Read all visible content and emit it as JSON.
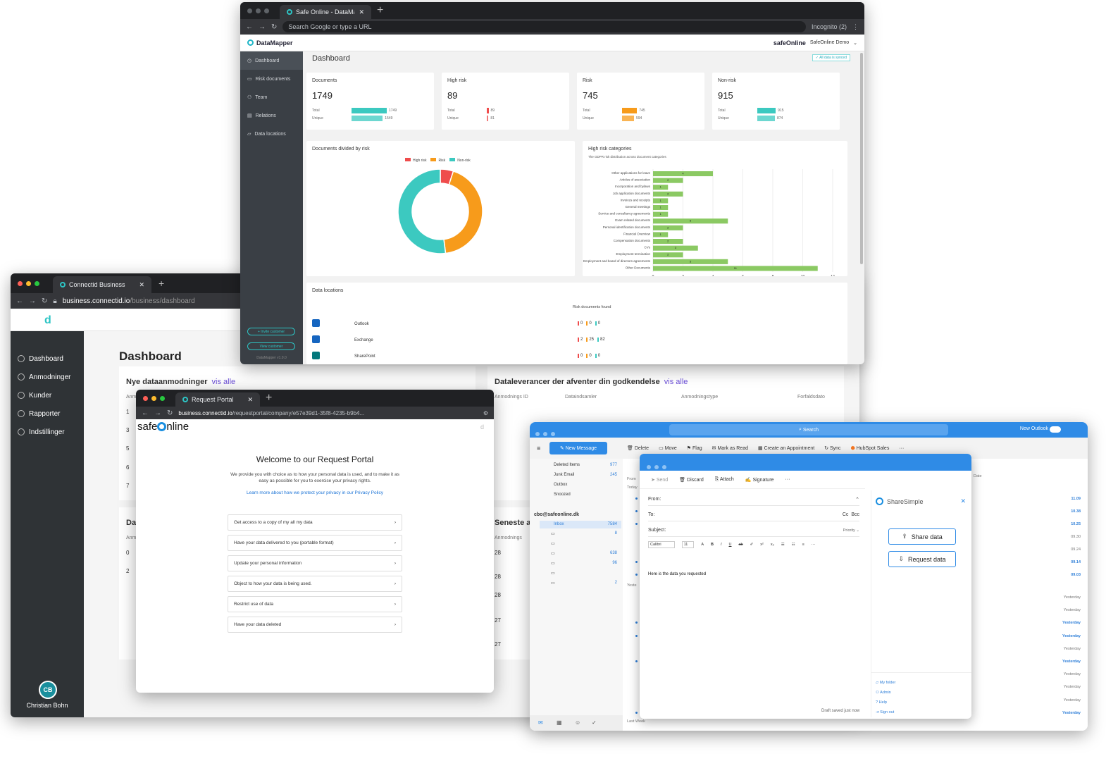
{
  "datamapper": {
    "tab_title": "Safe Online - DataMapper",
    "address_placeholder": "Search Google or type a URL",
    "incognito": "Incognito (2)",
    "app_name": "DataMapper",
    "brand": "safeOnline",
    "account": "SafeOnline Demo",
    "page_title": "Dashboard",
    "synced": "✓ All data is synced",
    "nav": [
      "Dashboard",
      "Risk documents",
      "Team",
      "Relations",
      "Data locations"
    ],
    "invite_btn": "+ Invite customer",
    "view_btn": "View customer",
    "version": "DataMapper v1.0.0",
    "stats": [
      {
        "label": "Documents",
        "value": "1749",
        "total": "1749",
        "unique": "1549",
        "color": "#3cc9c0"
      },
      {
        "label": "High risk",
        "value": "89",
        "total": "89",
        "unique": "81",
        "color": "#ef4c4c"
      },
      {
        "label": "Risk",
        "value": "745",
        "total": "745",
        "unique": "594",
        "color": "#f79b1b"
      },
      {
        "label": "Non-risk",
        "value": "915",
        "total": "915",
        "unique": "874",
        "color": "#3cc9c0"
      }
    ],
    "total_label": "Total",
    "unique_label": "Unique",
    "donut_title": "Documents divided by risk",
    "legend": [
      "High risk",
      "Risk",
      "Non-risk"
    ],
    "donut_fractions": [
      0.05,
      0.43,
      0.52
    ],
    "hbar_title": "High risk categories",
    "hbar_subtitle": "The GDPR risk distribution across document categories",
    "hbar_ticks": [
      "0",
      "2",
      "4",
      "6",
      "8",
      "10",
      "12"
    ],
    "hbar_categories": [
      "Other applications for leave",
      "Articles of association",
      "Incorporation and bylaws",
      "Job application documents",
      "Invoices and receipts",
      "General meetings",
      "Service and consultancy agreements",
      "Exam related documents",
      "Personal identification documents",
      "Financial Overview",
      "Compensation documents",
      "CVs",
      "Employment termination",
      "Employment and board of directors agreements",
      "Other Documents"
    ],
    "hbar_values": [
      4,
      2,
      1,
      2,
      1,
      1,
      1,
      5,
      2,
      1,
      2,
      3,
      2,
      5,
      11
    ],
    "locations_title": "Data locations",
    "locations_col": "Risk documents found",
    "locations": [
      {
        "name": "Outlook",
        "h": "0",
        "r": "0",
        "n": "0"
      },
      {
        "name": "Exchange",
        "h": "2",
        "r": "25",
        "n": "82"
      },
      {
        "name": "SharePoint",
        "h": "0",
        "r": "0",
        "n": "0"
      }
    ]
  },
  "connectid": {
    "tab_title": "Connectid Business",
    "url_host": "business.connectid.io",
    "url_path": "/business/dashboard",
    "page_title": "Dashboard",
    "nav": [
      "Dashboard",
      "Anmodninger",
      "Kunder",
      "Rapporter",
      "Indstillinger"
    ],
    "avatar": "CB",
    "user": "Christian Bohn",
    "panel1_title": "Nye dataanmodninger",
    "panel1_link": "vis alle",
    "panel1_col": "Anm",
    "panel1_rows": [
      "1",
      "3",
      "5",
      "6",
      "7"
    ],
    "panel2_title": "Dataleverancer der afventer din godkendelse",
    "panel2_link": "vis alle",
    "panel2_cols": [
      "Anmodnings ID",
      "Dataindsamler",
      "Anmodningstype",
      "Forfaldsdato"
    ],
    "panel3_title": "Da",
    "panel3_col": "Anm",
    "panel3_rows": [
      "0",
      "2"
    ],
    "panel4_title": "Seneste a",
    "panel4_col": "Anmodnings",
    "panel4_rows": [
      "28",
      "28",
      "28",
      "27",
      "27"
    ]
  },
  "portal": {
    "tab_title": "Request Portal",
    "url_host": "business.connectid.io",
    "url_path": "/requestportal/company/e57e39d1-35f8-4235-b9b4...",
    "brand_a": "safe",
    "brand_b": "nline",
    "title": "Welcome to our Request Portal",
    "text": "We provide you with choice as to how your personal data is used, and to make it as easy as possible for you to exercise your privacy rights.",
    "link": "Learn more about how we protect your privacy in our Privacy Policy",
    "options": [
      "Get access to a copy of my all my data",
      "Have your data delivered to you (portable format)",
      "Update your personal information",
      "Object to how your data is being used.",
      "Restrict use of data",
      "Have your data deleted"
    ]
  },
  "outlook": {
    "search": "Search",
    "new_outlook": "New Outlook",
    "new_message": "New Message",
    "toolbar": [
      "Delete",
      "Move",
      "Flag",
      "Mark as Read",
      "Create an Appointment",
      "Sync",
      "HubSpot Sales",
      "···"
    ],
    "folders": [
      {
        "name": "Deleted Items",
        "count": "977"
      },
      {
        "name": "Junk Email",
        "count": "245"
      },
      {
        "name": "Outbox",
        "count": ""
      },
      {
        "name": "Snoozed",
        "count": ""
      }
    ],
    "account": "cbo@safeonline.dk",
    "inbox": "Inbox",
    "inbox_count": "7584",
    "sub_counts": [
      "8",
      "",
      "638",
      "96",
      "",
      "2"
    ],
    "times": [
      "11.09",
      "10.38",
      "10.25",
      "09.30",
      "09.24",
      "09.14",
      "09.03",
      "Yesterday",
      "Yesterday",
      "Yesterday",
      "Yesterday",
      "Yesterday",
      "Yesterday",
      "Yesterday",
      "Yesterday",
      "Yesterday",
      "Yesterday"
    ],
    "date_col": "Date",
    "from_col": "From",
    "today": "Today",
    "yesterday": "Yeste",
    "last_week": "Last Week"
  },
  "compose": {
    "toolbar": [
      "Send",
      "Discard",
      "Attach",
      "Signature",
      "···"
    ],
    "from_label": "From:",
    "to_label": "To:",
    "cc": "Cc",
    "bcc": "Bcc",
    "subject_label": "Subject:",
    "priority": "Priority",
    "font": "Calibri",
    "font_size": "11",
    "body": "Here is the data you requested",
    "draft": "Draft saved just now",
    "addin": "ShareSimple",
    "share_btn": "Share data",
    "request_btn": "Request data",
    "links": [
      "My folder",
      "Admin",
      "Help",
      "Sign out"
    ]
  }
}
